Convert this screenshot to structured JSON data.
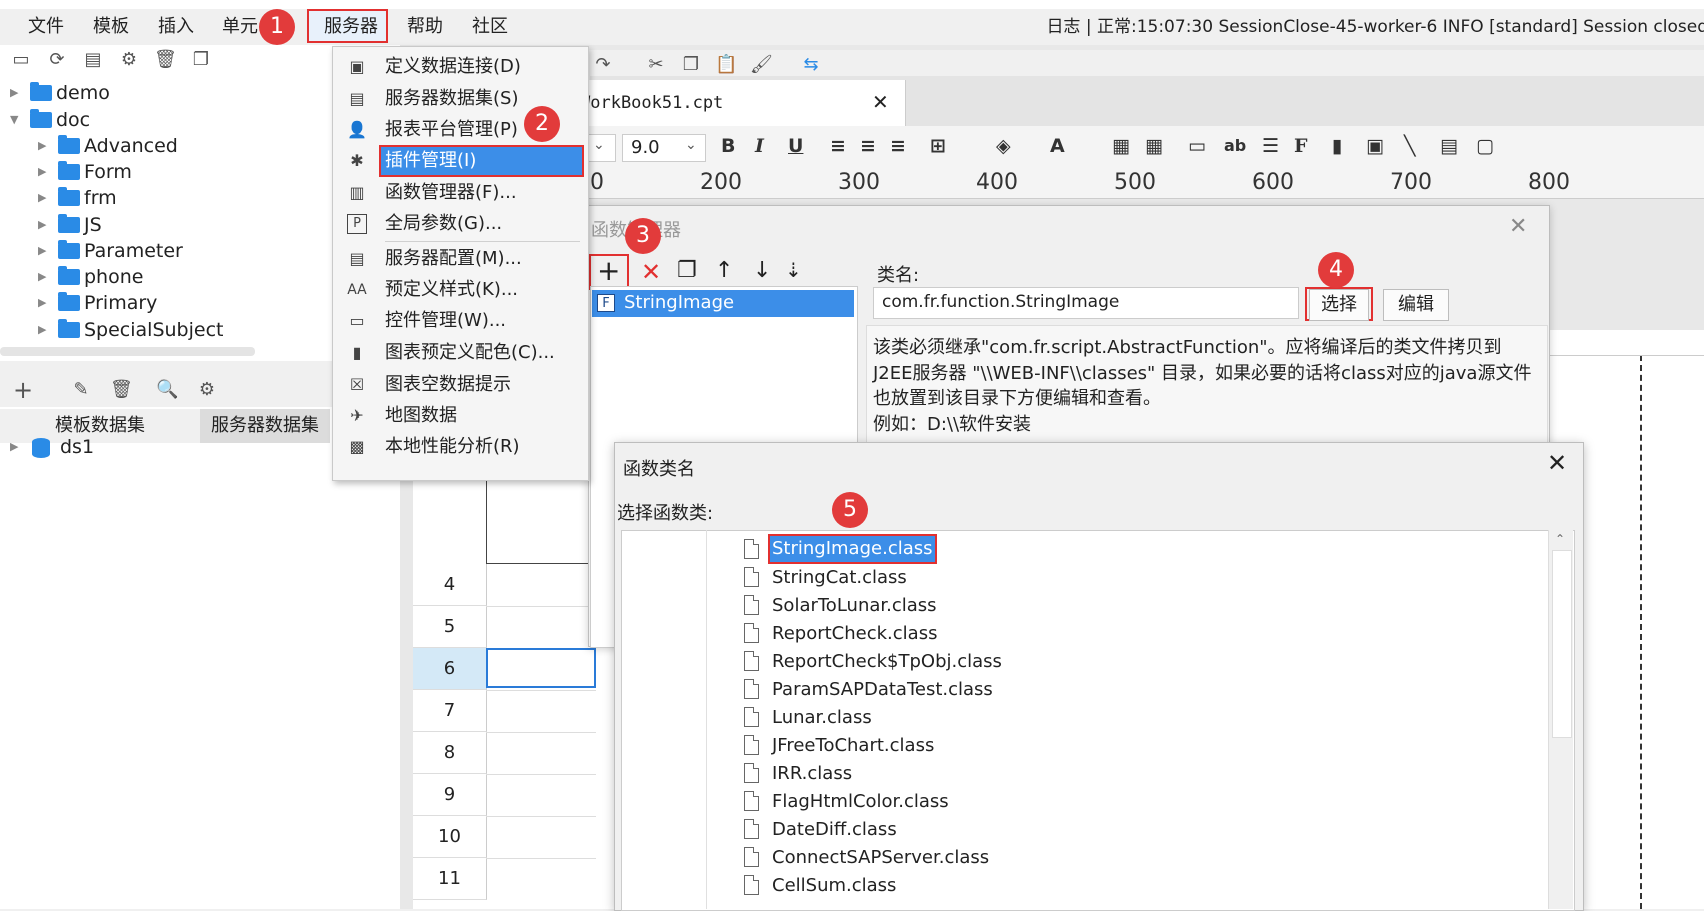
{
  "menubar": {
    "items": [
      "文件",
      "模板",
      "插入",
      "单元格",
      "服务器",
      "帮助",
      "社区"
    ],
    "log_text": "日志 | 正常:15:07:30 SessionClose-45-worker-6 INFO [standard] Session closed"
  },
  "badges": [
    "1",
    "2",
    "3",
    "4",
    "5"
  ],
  "server_menu": {
    "items": [
      {
        "label": "定义数据连接(D)",
        "icon": "database-connection-icon"
      },
      {
        "label": "服务器数据集(S)",
        "icon": "server-dataset-icon"
      },
      {
        "label": "报表平台管理(P)",
        "icon": "user-icon"
      },
      {
        "label": "插件管理(I)",
        "icon": "puzzle-icon"
      },
      {
        "label": "函数管理器(F)...",
        "icon": "function-icon"
      },
      {
        "label": "全局参数(G)...",
        "icon": "parameter-icon"
      },
      {
        "label": "服务器配置(M)...",
        "icon": "server-config-icon"
      },
      {
        "label": "预定义样式(K)...",
        "icon": "style-icon"
      },
      {
        "label": "控件管理(W)...",
        "icon": "widget-icon"
      },
      {
        "label": "图表预定义配色(C)...",
        "icon": "chart-color-icon"
      },
      {
        "label": "图表空数据提示",
        "icon": "chart-empty-icon"
      },
      {
        "label": "地图数据",
        "icon": "map-icon"
      },
      {
        "label": "本地性能分析(R)",
        "icon": "performance-icon"
      }
    ]
  },
  "tree": {
    "items": [
      {
        "label": "demo",
        "level": 0,
        "open": false
      },
      {
        "label": "doc",
        "level": 0,
        "open": true
      },
      {
        "label": "Advanced",
        "level": 1
      },
      {
        "label": "Form",
        "level": 1
      },
      {
        "label": "frm",
        "level": 1
      },
      {
        "label": "JS",
        "level": 1
      },
      {
        "label": "Parameter",
        "level": 1
      },
      {
        "label": "phone",
        "level": 1
      },
      {
        "label": "Primary",
        "level": 1
      },
      {
        "label": "SpecialSubject",
        "level": 1
      }
    ]
  },
  "dataset_tabs": [
    "模板数据集",
    "服务器数据集"
  ],
  "datasets": [
    "ds1"
  ],
  "document": {
    "tab_title": "WorkBook51.cpt",
    "font_size": "9.0",
    "ruler": [
      "100",
      "200",
      "300",
      "400",
      "500",
      "600",
      "700",
      "800"
    ],
    "rows": [
      "4",
      "5",
      "6",
      "7",
      "8",
      "9",
      "10",
      "11"
    ]
  },
  "function_manager": {
    "title": "函数管理器",
    "functions": [
      "StringImage"
    ],
    "class_label": "类名:",
    "class_value": "com.fr.function.StringImage",
    "select_button": "选择",
    "edit_button": "编辑",
    "description": [
      "该类必须继承\"com.fr.script.AbstractFunction\"。应将编译后的类文件拷贝到",
      "J2EE服务器 \"\\\\WEB-INF\\\\classes\" 目录，如果必要的话将class对应的java源文件",
      "也放置到该目录下方便编辑和查看。",
      "例如：D:\\\\软件安装"
    ]
  },
  "function_class_dialog": {
    "title": "函数类名",
    "prompt": "选择函数类:",
    "classes": [
      "StringImage.class",
      "StringCat.class",
      "SolarToLunar.class",
      "ReportCheck.class",
      "ReportCheck$TpObj.class",
      "ParamSAPDataTest.class",
      "Lunar.class",
      "JFreeToChart.class",
      "IRR.class",
      "FlagHtmlColor.class",
      "DateDiff.class",
      "ConnectSAPServer.class",
      "CellSum.class"
    ],
    "selected": "StringImage.class"
  },
  "colors": {
    "accent": "#3c8ee8",
    "highlight_red": "#e23030",
    "folder": "#2a8be6"
  }
}
